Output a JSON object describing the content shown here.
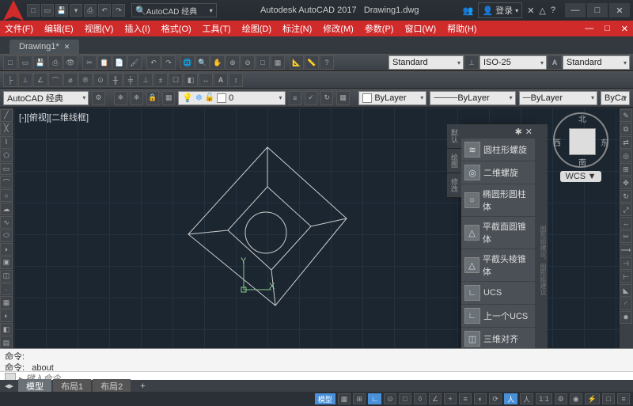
{
  "title": {
    "app": "Autodesk AutoCAD 2017",
    "doc": "Drawing1.dwg"
  },
  "search": {
    "placeholder": "AutoCAD 经典"
  },
  "login": "登录",
  "menu": [
    "文件(F)",
    "编辑(E)",
    "视图(V)",
    "插入(I)",
    "格式(O)",
    "工具(T)",
    "绘图(D)",
    "标注(N)",
    "修改(M)",
    "参数(P)",
    "窗口(W)",
    "帮助(H)"
  ],
  "doc_tab": "Drawing1*",
  "props": {
    "workspace": "AutoCAD 经典",
    "layer": "0",
    "style1": "Standard",
    "style2": "ISO-25",
    "style3": "Standard",
    "color": "ByLayer",
    "ltype": "ByLayer",
    "lweight": "ByCa"
  },
  "viewport_label": "[-][俯视][二维线框]",
  "viewcube": {
    "n": "北",
    "s": "南",
    "e": "东",
    "w": "西",
    "wcs": "WCS",
    "down": "▼"
  },
  "ucs": {
    "x": "X",
    "y": "Y"
  },
  "palette": {
    "close": "✕",
    "opts": "✱",
    "tabs": [
      "默认",
      "绘图",
      "修改"
    ],
    "side_text": "图形组建议。图形组建议",
    "items": [
      {
        "icon": "≋",
        "label": "圆柱形螺旋"
      },
      {
        "icon": "◎",
        "label": "二维螺旋"
      },
      {
        "icon": "○",
        "label": "椭圆形圆柱体"
      },
      {
        "icon": "△",
        "label": "平截面圆锥体"
      },
      {
        "icon": "△",
        "label": "平截头棱锥体"
      },
      {
        "icon": "∟",
        "label": "UCS"
      },
      {
        "icon": "∟",
        "label": "上一个UCS"
      },
      {
        "icon": "◫",
        "label": "三维对齐"
      }
    ]
  },
  "cmd": {
    "hist1": "命令:",
    "hist2": "命令: _about",
    "prompt_icon": "▸",
    "placeholder": "键入命令"
  },
  "bottom_tabs": [
    "模型",
    "布局1",
    "布局2",
    "+"
  ],
  "status": {
    "model": "模型",
    "scale": "1:1"
  }
}
